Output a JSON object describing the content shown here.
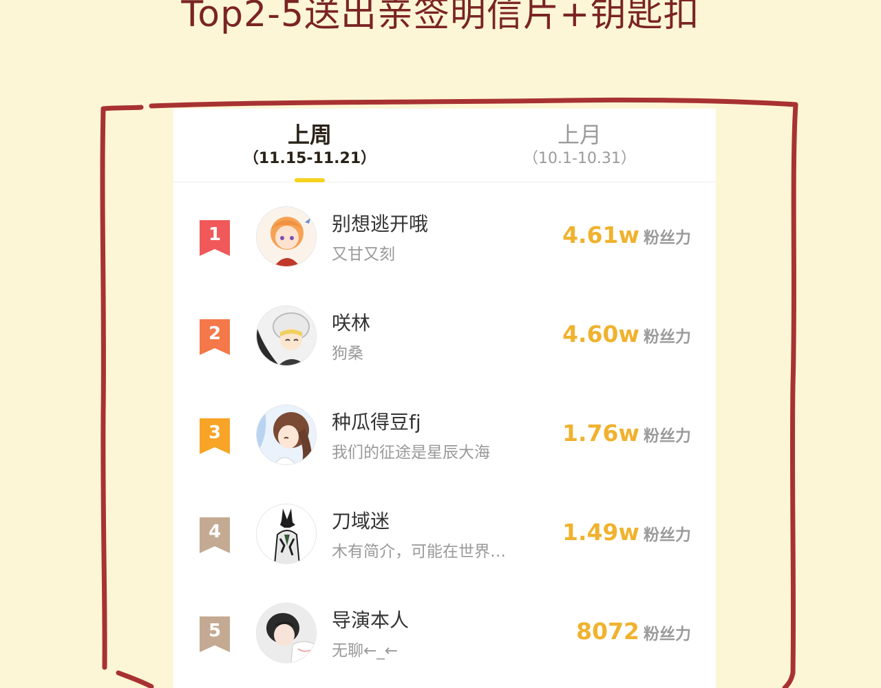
{
  "banner": {
    "title": "Top2-5送出亲签明信片+钥匙扣"
  },
  "colors": {
    "background": "#fdf6d6",
    "frame": "#a83232",
    "accent": "#f5d21e",
    "fans_value": "#f0b22e",
    "rank_1": "#f0585a",
    "rank_2": "#f4784a",
    "rank_3": "#f8a426",
    "rank_other": "#c4aa92"
  },
  "tabs": [
    {
      "label": "上周",
      "range": "（11.15-11.21）",
      "selected": true
    },
    {
      "label": "上月",
      "range": "（10.1-10.31）",
      "selected": false
    }
  ],
  "ranking": [
    {
      "rank": "1",
      "name": "别想逃开哦",
      "bio": "又甘又刻",
      "fans_value": "4.61w",
      "fans_unit": "粉丝力",
      "avatar_icon": "anime-girl-avatar"
    },
    {
      "rank": "2",
      "name": "咲林",
      "bio": "狗桑",
      "fans_value": "4.60w",
      "fans_unit": "粉丝力",
      "avatar_icon": "knit-hat-boy-avatar"
    },
    {
      "rank": "3",
      "name": "种瓜得豆fj",
      "bio": "我们的征途是星辰大海",
      "fans_value": "1.76w",
      "fans_unit": "粉丝力",
      "avatar_icon": "brown-hair-girl-avatar"
    },
    {
      "rank": "4",
      "name": "刀域迷",
      "bio": "木有简介，可能在世界…",
      "fans_value": "1.49w",
      "fans_unit": "粉丝力",
      "avatar_icon": "jackal-warrior-avatar"
    },
    {
      "rank": "5",
      "name": "导演本人",
      "bio": "无聊←_←",
      "fans_value": "8072",
      "fans_unit": "粉丝力",
      "avatar_icon": "dark-hair-boy-avatar"
    }
  ]
}
